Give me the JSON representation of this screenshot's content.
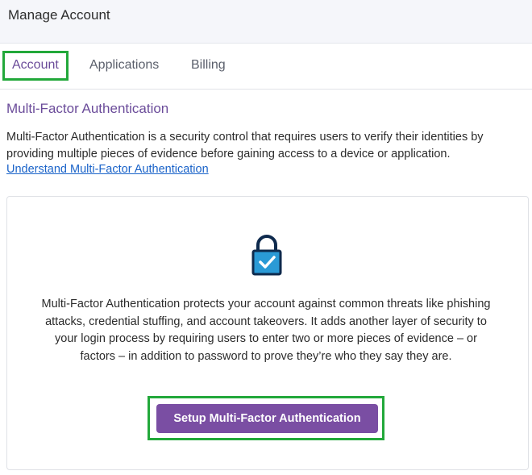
{
  "header": {
    "title": "Manage Account"
  },
  "tabs": [
    {
      "label": "Account",
      "active": true
    },
    {
      "label": "Applications",
      "active": false
    },
    {
      "label": "Billing",
      "active": false
    }
  ],
  "mfa": {
    "section_title": "Multi-Factor Authentication",
    "description": "Multi-Factor Authentication is a security control that requires users to verify their identities by providing multiple pieces of evidence before gaining access to a device or application.",
    "link_label": "Understand Multi-Factor Authentication",
    "card_text": "Multi-Factor Authentication protects your account against common threats like phishing attacks, credential stuffing, and account takeovers. It adds another layer of security to your login process by requiring users to enter two or more pieces of evidence – or factors – in addition to password to prove they’re who they say they are.",
    "setup_button_label": "Setup Multi-Factor Authentication",
    "icon": "lock-check-icon"
  },
  "colors": {
    "accent_purple": "#6b4c9a",
    "button_purple": "#7a4ea3",
    "link_blue": "#1a63c9",
    "highlight_green": "#22a83a",
    "lock_blue": "#2a9ad6",
    "lock_navy": "#0e2a4d"
  }
}
